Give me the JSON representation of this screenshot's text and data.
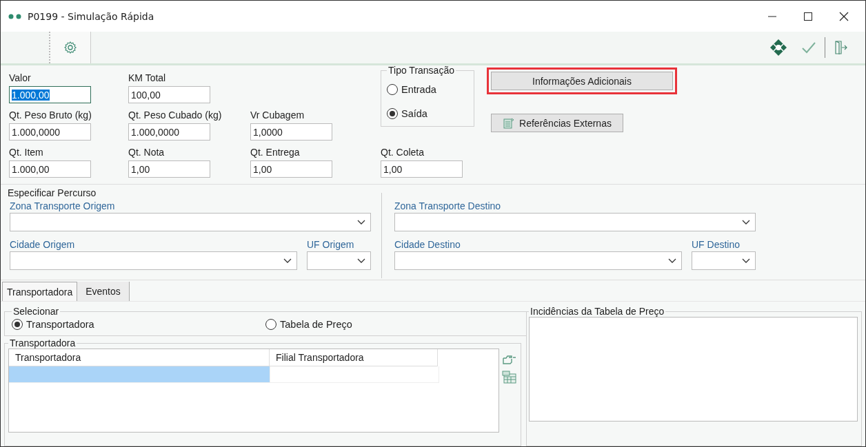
{
  "window": {
    "title": "P0199 - Simulação Rápida"
  },
  "fields": [
    [
      {
        "label": "Valor",
        "value": "1.000,00",
        "focused": true
      },
      {
        "label": "KM Total",
        "value": "100,00",
        "focused": false
      }
    ],
    [
      {
        "label": "Qt. Peso Bruto (kg)",
        "value": "1.000,0000",
        "focused": false
      },
      {
        "label": "Qt. Peso Cubado (kg)",
        "value": "1.000,0000",
        "focused": false
      },
      {
        "label": "Vr Cubagem",
        "value": "1,0000",
        "focused": false
      }
    ],
    [
      {
        "label": "Qt. Item",
        "value": "1.000,00",
        "focused": false
      },
      {
        "label": "Qt. Nota",
        "value": "1,00",
        "focused": false
      },
      {
        "label": "Qt. Entrega",
        "value": "1,00",
        "focused": false
      },
      {
        "label": "Qt. Coleta",
        "value": "1,00",
        "focused": false
      }
    ]
  ],
  "tipo_transacao": {
    "title": "Tipo Transação",
    "options": [
      {
        "label": "Entrada",
        "selected": false
      },
      {
        "label": "Saída",
        "selected": true
      }
    ]
  },
  "buttons": [
    {
      "label": "Informações Adicionais",
      "highlighted": true,
      "kind": "plain"
    },
    {
      "label": "Referências Externas",
      "highlighted": false,
      "kind": "icon"
    }
  ],
  "percurso": {
    "title": "Especificar Percurso",
    "origem": {
      "zona": "Zona Transporte Origem",
      "cidade": "Cidade Origem",
      "uf": "UF Origem"
    },
    "destino": {
      "zona": "Zona Transporte Destino",
      "cidade": "Cidade Destino",
      "uf": "UF Destino"
    }
  },
  "tabs": [
    {
      "label": "Transportadora",
      "selected": true
    },
    {
      "label": "Eventos",
      "selected": false
    }
  ],
  "selecionar": {
    "title": "Selecionar",
    "options": [
      {
        "label": "Transportadora",
        "selected": true
      },
      {
        "label": "Tabela de Preço",
        "selected": false
      }
    ]
  },
  "transportadora": {
    "title": "Transportadora",
    "columns": [
      "Transportadora",
      "Filial Transportadora"
    ],
    "rows": [
      {
        "selected": true
      }
    ]
  },
  "incidencias": {
    "title": "Incidências da Tabela de Preço"
  }
}
